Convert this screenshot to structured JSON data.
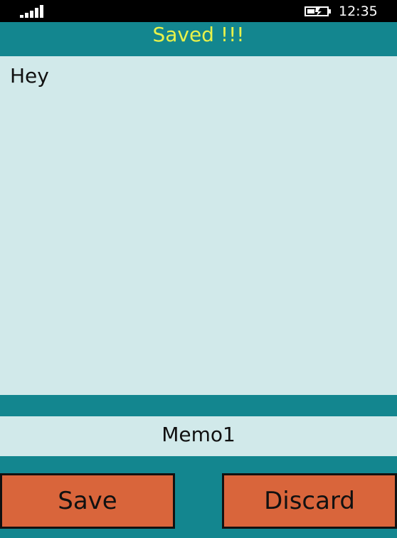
{
  "status_bar": {
    "time": "12:35",
    "signal_icon": "signal-strength-icon",
    "battery_icon": "battery-charging-icon"
  },
  "header": {
    "title": "Saved !!!"
  },
  "memo": {
    "text": "Hey"
  },
  "name_field": {
    "value": "Memo1"
  },
  "actions": {
    "save_label": "Save",
    "discard_label": "Discard"
  },
  "colors": {
    "background": "#13868f",
    "field": "#d1e9ea",
    "title": "#e8f24a",
    "button": "#d9653b"
  }
}
